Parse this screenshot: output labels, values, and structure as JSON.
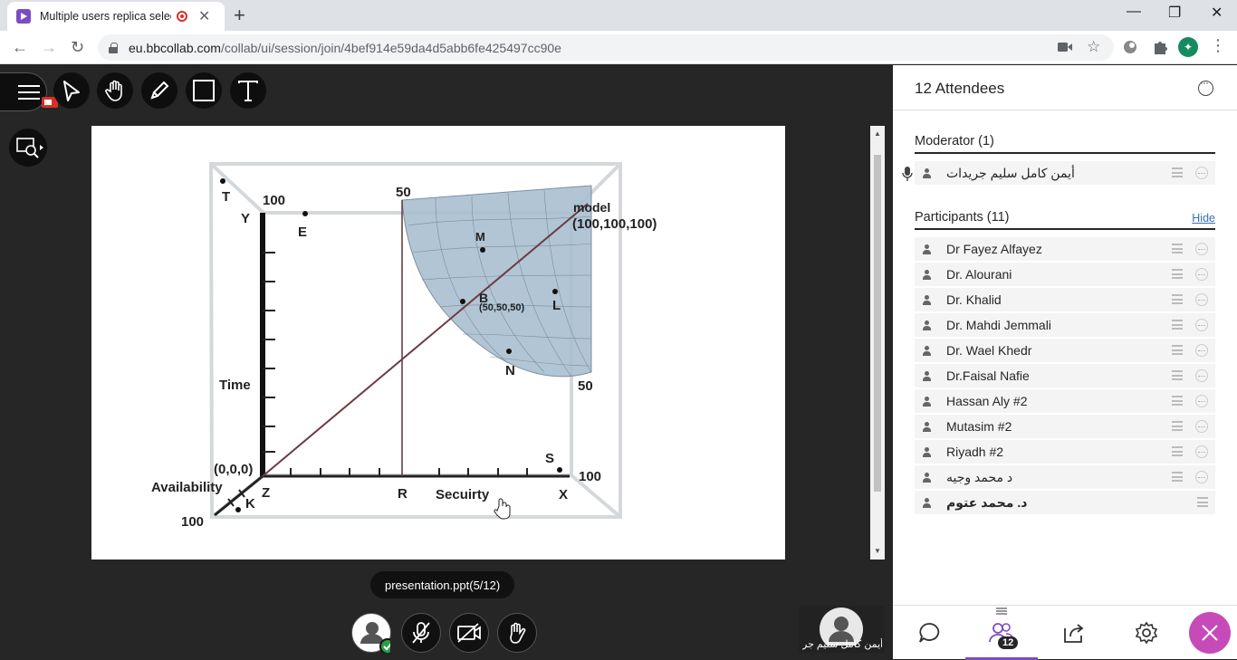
{
  "browser": {
    "tab_title": "Multiple users replica selectio",
    "url_domain": "eu.bbcollab.com",
    "url_path": "/collab/ui/session/join/4bef914e59da4d5abb6fe425497cc90e",
    "profile_initial": "✦"
  },
  "stage": {
    "file_name": "presentation.ppt",
    "page_counter": "(5/12)",
    "self_name": "أيمن كامل سليم جر..."
  },
  "slide": {
    "labels": {
      "T": "T",
      "Y": "Y",
      "E": "E",
      "v100_top": "100",
      "v50_top": "50",
      "model": "model",
      "model_coords": "(100,100,100)",
      "M": "M",
      "B": "B",
      "B_coords": "(50,50,50)",
      "L": "L",
      "N": "N",
      "v50_right": "50",
      "time": "Time",
      "origin": "(0,0,0)",
      "availability": "Availability",
      "Z": "Z",
      "K": "K",
      "v100_bottom": "100",
      "R": "R",
      "security": "Secuirty",
      "X": "X",
      "S": "S",
      "v100_right": "100"
    }
  },
  "panel": {
    "title": "12 Attendees",
    "moderator_title": "Moderator (1)",
    "moderators": [
      "أيمن كامل سليم جريدات"
    ],
    "participants_title": "Participants (11)",
    "hide_label": "Hide",
    "participants": [
      "Dr Fayez Alfayez",
      "Dr. Alourani",
      "Dr. Khalid",
      "Dr. Mahdi Jemmali",
      "Dr. Wael Khedr",
      "Dr.Faisal Nafie",
      "Hassan Aly #2",
      "Mutasim #2",
      "Riyadh #2",
      "د محمد وجيه",
      "د. محمد عتوم"
    ],
    "attendee_badge": "12"
  }
}
